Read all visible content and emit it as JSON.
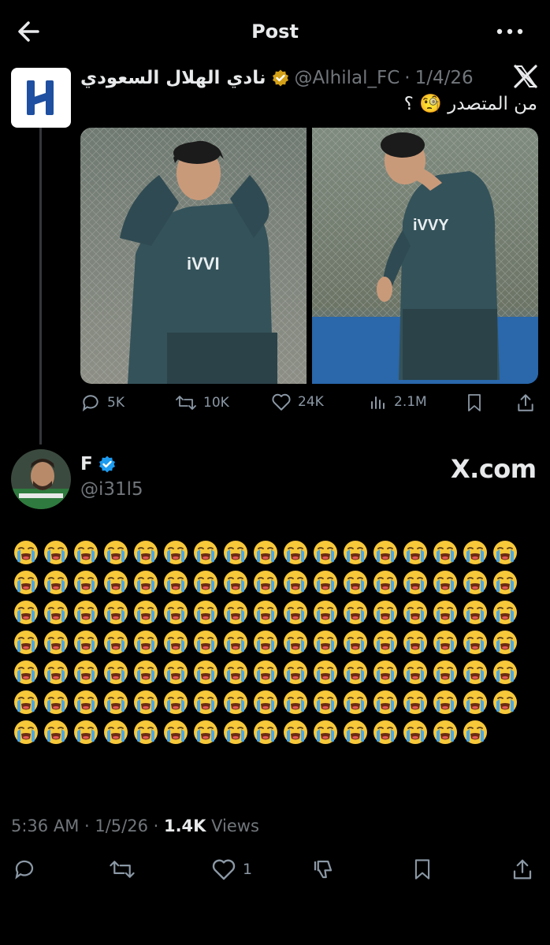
{
  "header": {
    "title": "Post"
  },
  "quoted": {
    "name": "نادي الهلال السعودي",
    "handle": "@Alhilal_FC",
    "dot": "·",
    "date": "1/4/26",
    "text": "من المتصدر 🧐 ؟",
    "stats": {
      "replies": "5K",
      "reposts": "10K",
      "likes": "24K",
      "views": "2.1M"
    }
  },
  "reply": {
    "name": "F",
    "handle": "@i31l5",
    "source": "X.com",
    "emoji": "😭",
    "emoji_count": 118,
    "meta": {
      "time_date": "5:36 AM · 1/5/26 · ",
      "views_count": "1.4K",
      "views_label": " Views"
    },
    "likes": "1"
  },
  "icons": [
    "back-arrow-icon",
    "more-icon",
    "verified-icon",
    "x-logo-icon",
    "reply-icon",
    "repost-icon",
    "like-icon",
    "views-icon",
    "bookmark-icon",
    "share-icon",
    "dislike-icon"
  ],
  "colors": {
    "background": "#000000",
    "text": "#e7e9ea",
    "muted": "#71767b",
    "verified_blue": "#1d9bf0",
    "verified_gold": "#d4a017"
  }
}
